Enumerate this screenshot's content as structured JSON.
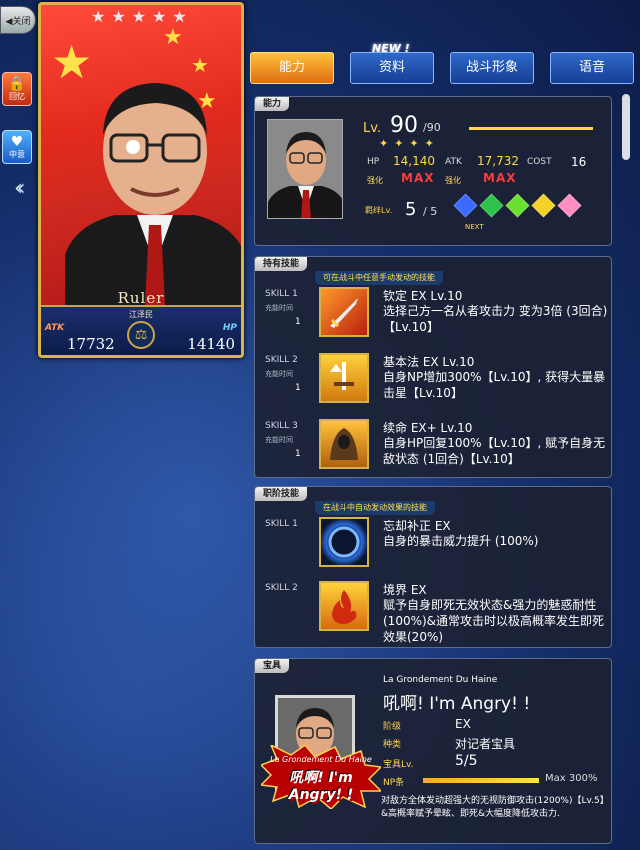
{
  "nav": {
    "close": "◀关闭"
  },
  "side": {
    "btn1": "回忆",
    "btn2": "中意"
  },
  "card": {
    "class": "Ruler",
    "name": "江泽民",
    "atk_label": "ATK",
    "hp_label": "HP",
    "atk": "17732",
    "hp": "14140"
  },
  "tabs": [
    {
      "label": "能力",
      "active": true
    },
    {
      "label": "资料",
      "active": false
    },
    {
      "label": "战斗形象",
      "active": false
    },
    {
      "label": "语音",
      "active": false
    }
  ],
  "new_badge": "NEW !",
  "ability": {
    "header": "能力",
    "lv_label": "Lv.",
    "lv": "90",
    "lv_max": "/90",
    "lv_progress": 1.0,
    "hp_label": "HP",
    "hp": "14,140",
    "atk_label": "ATK",
    "atk": "17,732",
    "cost_label": "COST",
    "cost": "16",
    "hp_enh": "强化",
    "atk_enh": "强化",
    "hp_max": "MAX",
    "atk_max": "MAX",
    "bond_label": "羁绊Lv.",
    "bond": "5",
    "bond_max": "/ 5",
    "next": "NEXT",
    "gem_colors": [
      "#3a6bff",
      "#2fc24a",
      "#6be030",
      "#f2d22a",
      "#ff8fc0"
    ]
  },
  "active_skills": {
    "header": "持有技能",
    "subheader": "可在战斗中任意手动发动的技能",
    "cd_label": "充能时间",
    "items": [
      {
        "tag": "SKILL 1",
        "cd": "1",
        "title": "钦定 EX Lv.10",
        "desc": "选择己方一名从者攻击力 变为3倍 (3回合) 【Lv.10】",
        "icon": "sword-icon"
      },
      {
        "tag": "SKILL 2",
        "cd": "1",
        "title": "基本法 EX Lv.10",
        "desc": "自身NP增加300%【Lv.10】, 获得大量暴击星【Lv.10】",
        "icon": "sword-up-icon"
      },
      {
        "tag": "SKILL 3",
        "cd": "1",
        "title": "续命 EX+ Lv.10",
        "desc": "自身HP回复100%【Lv.10】, 赋予自身无敌状态 (1回合)【Lv.10】",
        "icon": "cloak-icon"
      }
    ]
  },
  "class_skills": {
    "header": "职阶技能",
    "subheader": "在战斗中自动发动效果的技能",
    "items": [
      {
        "tag": "SKILL 1",
        "title": "忘却补正 EX",
        "desc": "自身的暴击威力提升 (100%)",
        "icon": "ring-icon"
      },
      {
        "tag": "SKILL 2",
        "title": "境界 EX",
        "desc": "赋予自身即死无效状态&强力的魅惑耐性(100%)&通常攻击时以极高概率发生即死效果(20%)",
        "icon": "flame-icon"
      }
    ]
  },
  "noble_phantasm": {
    "header": "宝具",
    "name_en": "La Grondement Du Haine",
    "name": "吼啊! I'm Angry! !",
    "rank_label": "阶级",
    "rank": "EX",
    "type_label": "种类",
    "type": "对记者宝具",
    "lv_label": "宝具Lv.",
    "lv": "5/5",
    "np_label": "NP条",
    "np_level": 1.0,
    "np_max": "Max 300%",
    "desc": "对敌方全体发动超强大的无视防御攻击(1200%)【Lv.5】&高概率赋予晕眩、即死&大幅度降低攻击力.",
    "burst_line1": "La Grondement Du Haine",
    "burst_line2": "吼啊! I'm Angry! !"
  }
}
